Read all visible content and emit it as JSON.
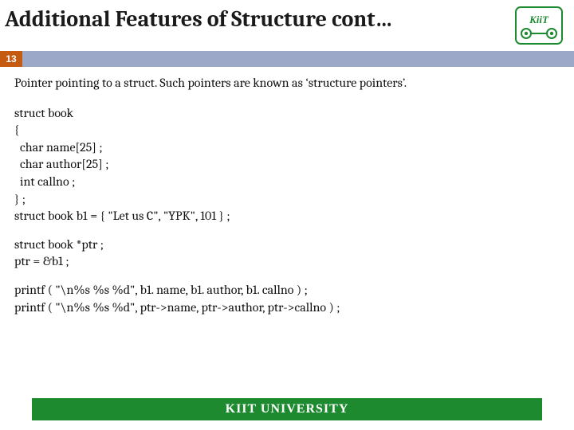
{
  "header": {
    "title": "Additional Features of Structure cont…",
    "logo_label": "KiiT logo"
  },
  "page_number": "13",
  "intro": "Pointer pointing to a struct. Such pointers are known as ‘structure pointers’.",
  "code_block_1": "struct book\n{\n  char name[25] ;\n  char author[25] ;\n  int callno ;\n} ;\nstruct book b1 = { \"Let us C\", \"YPK\", 101 } ;",
  "code_block_2": "struct book *ptr ;\nptr = &b1 ;",
  "code_block_3": "printf ( \"\\n%s %s %d\", b1. name, b1. author, b1. callno ) ;\nprintf ( \"\\n%s %s %d\", ptr->name, ptr->author, ptr->callno ) ;",
  "footer": {
    "text": "KIIT UNIVERSITY"
  }
}
